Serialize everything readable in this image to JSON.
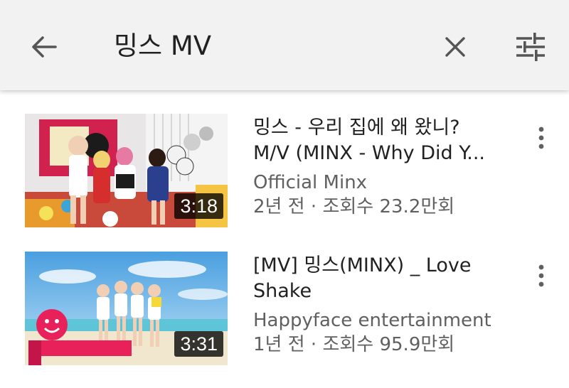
{
  "search": {
    "query": "밍스 MV"
  },
  "icons": {
    "back": "arrow-left-icon",
    "clear": "close-icon",
    "filter": "sliders-icon",
    "more": "more-vertical-icon"
  },
  "colors": {
    "topbar_bg": "#f2f2f2",
    "text_primary": "#212121",
    "text_secondary": "#606060"
  },
  "results": [
    {
      "title_line1": "밍스 - 우리 집에 왜 왔니?",
      "title_line2": "M/V (MINX - Why Did Y...",
      "channel": "Official Minx",
      "stats": "2년 전 · 조회수 23.2만회",
      "duration": "3:18"
    },
    {
      "title_line1": "[MV] 밍스(MINX) _ Love",
      "title_line2": "Shake",
      "channel": "Happyface entertainment",
      "stats": "1년 전 · 조회수 95.9만회",
      "duration": "3:31"
    }
  ]
}
